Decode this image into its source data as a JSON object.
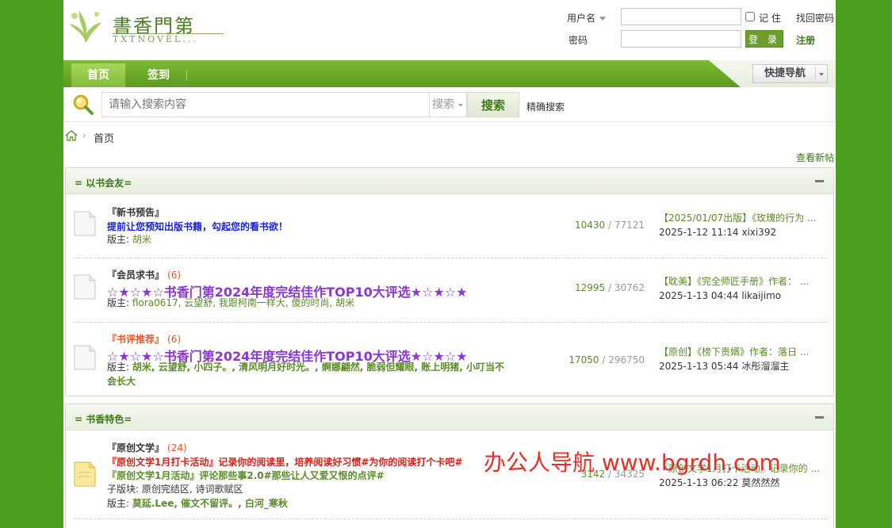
{
  "logo": {
    "title": "書香門第",
    "subtitle": "TXTNOVEL..."
  },
  "login": {
    "username_label": "用户名",
    "password_label": "密码",
    "remember_label": "记 住",
    "forgot_label": "找回密码",
    "login_button": "登 录",
    "register_label": "注册",
    "username_value": "",
    "password_value": ""
  },
  "nav": {
    "home": "首页",
    "checkin": "签到",
    "quick_nav": "快捷导航"
  },
  "search": {
    "placeholder": "请输入搜索内容",
    "type_label": "搜索",
    "button": "搜索",
    "precise": "精确搜索"
  },
  "breadcrumb": {
    "current": "首页"
  },
  "new_posts": "查看新帖",
  "sections": [
    {
      "title": "= 以书会友=",
      "forums": [
        {
          "name": "『新书预告』",
          "count": "",
          "line1": "提前让您预知出版书籍，勾起您的看书欲！",
          "line1_color": "#1a23c8",
          "mods_label": "版主:",
          "mods": "胡米",
          "topics": "10430",
          "posts": "77121",
          "last_title": "【2025/01/07出版】《玫瑰的行为 ...",
          "last_meta": "2025-1-12 11:14 xixi392"
        },
        {
          "name": "『会员求书』",
          "count": "(6)",
          "line1": "☆★☆★☆书香门第2024年度完结佳作TOP10大评选★☆★☆★",
          "line1_color": "#8a35d4",
          "mods_label": "版主:",
          "mods": "flora0617, 云望舒, 我跟柯南一样大, 傻的时尚, 胡米",
          "topics": "12995",
          "posts": "30762",
          "last_title": "【耽美】《完全师匠手册》作者： ...",
          "last_meta": "2025-1-13 04:44 likaijimo"
        },
        {
          "name": "『书评推荐』",
          "count": "(6)",
          "line1": "☆★☆★☆书香门第2024年度完结佳作TOP10大评选★☆★☆★",
          "line1_color": "#8a35d4",
          "mods_label": "版主:",
          "mods_l1": "胡米, 云望舒, 小四子。, 清风明月好时光。, 婀娜翩然, 脆弱但耀眼, 账上明猪, 小叮当不",
          "mods_l2": "会长大",
          "topics": "17050",
          "posts": "296750",
          "last_title": "【原创】《榜下贵婿》作者：落日 ...",
          "last_meta": "2025-1-13 05:44 冰彤溜溜主"
        }
      ]
    },
    {
      "title": "= 书香特色=",
      "forums": [
        {
          "name": "『原创文学』",
          "count": "(24)",
          "line1": "『原创文学1月打卡活动』记录你的阅读里，培养阅读好习惯#为你的阅读打个卡吧#",
          "line1_color": "#d4201a",
          "line2": "『原创文学1月活动』评论那些事2.0#那些让人又爱又恨的点评#",
          "line2_color": "#5a8a27",
          "sub_label": "子版块:",
          "sub": "原创完结区, 诗词歌赋区",
          "mods_label": "版主:",
          "mods": "莫延.Lee, 催文不留评。, 白河_寒秋",
          "topics": "3142",
          "posts": "34325",
          "last_title": "『原创文学1月打卡活动』记录你的 ...",
          "last_meta": "2025-1-13 06:22 莫然然然"
        }
      ]
    }
  ],
  "watermark": "办公人导航  www.bgrdh.com",
  "colors": {
    "page_bg": "#4a9e1e",
    "nav_green": "#6ba82a",
    "link_green": "#5a8a27"
  }
}
